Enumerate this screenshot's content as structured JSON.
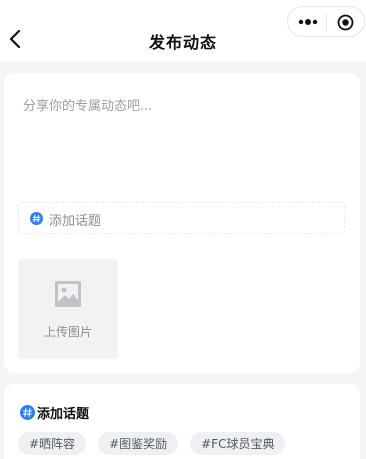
{
  "header": {
    "title": "发布动态",
    "back_icon": "chevron-left-icon",
    "capsule": {
      "more_icon": "more-dots-icon",
      "close_icon": "target-icon"
    }
  },
  "composer": {
    "placeholder": "分享你的专属动态吧...",
    "topic_field": {
      "icon": "hash-icon",
      "label": "添加话题"
    },
    "upload": {
      "icon": "image-icon",
      "label": "上传图片"
    }
  },
  "topics_card": {
    "title": "添加话题",
    "icon": "hash-icon",
    "tags": [
      "#晒阵容",
      "#图鉴奖励",
      "#FC球员宝典"
    ]
  },
  "colors": {
    "accent": "#2f7cf6",
    "background": "#f4f5f7"
  }
}
